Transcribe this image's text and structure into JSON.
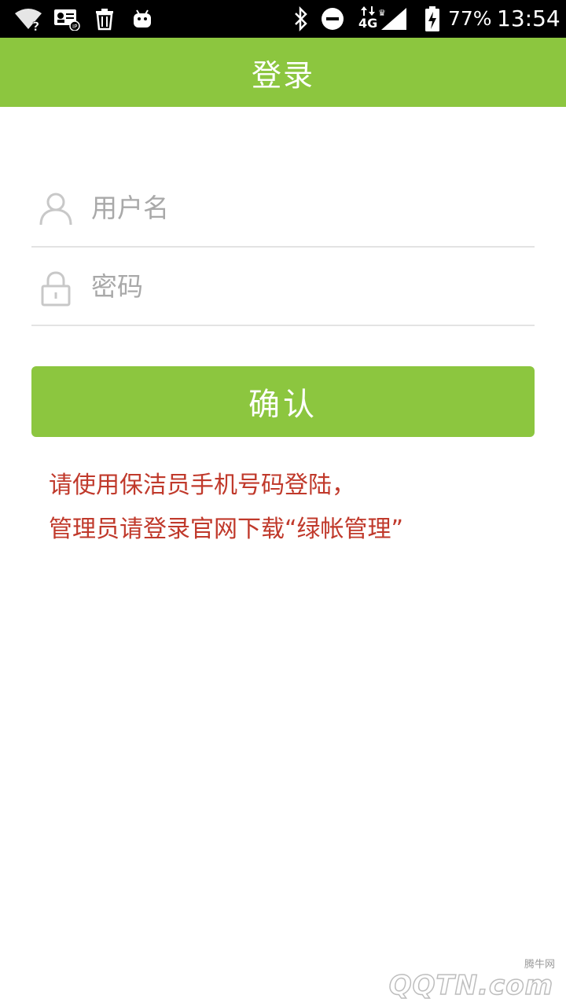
{
  "status_bar": {
    "battery": "77%",
    "time": "13:54",
    "network_type": "4G",
    "icons": [
      "wifi-unknown-icon",
      "contact-card-icon",
      "trash-icon",
      "android-icon",
      "bluetooth-icon",
      "do-not-disturb-icon",
      "signal-icon",
      "battery-charging-icon"
    ]
  },
  "header": {
    "title": "登录"
  },
  "form": {
    "username_placeholder": "用户名",
    "password_placeholder": "密码",
    "username_icon": "user-icon",
    "password_icon": "lock-icon",
    "submit_label": "确认"
  },
  "notice": {
    "line1": "请使用保洁员手机号码登陆，",
    "line2": "管理员请登录官网下载“绿帐管理”"
  },
  "watermark": {
    "site": "腾牛网",
    "brand": "QQTN.com"
  },
  "colors": {
    "accent": "#8cc63f",
    "notice_text": "#c0392b",
    "placeholder": "#a9a9a9",
    "divider": "#e3e3e3"
  }
}
